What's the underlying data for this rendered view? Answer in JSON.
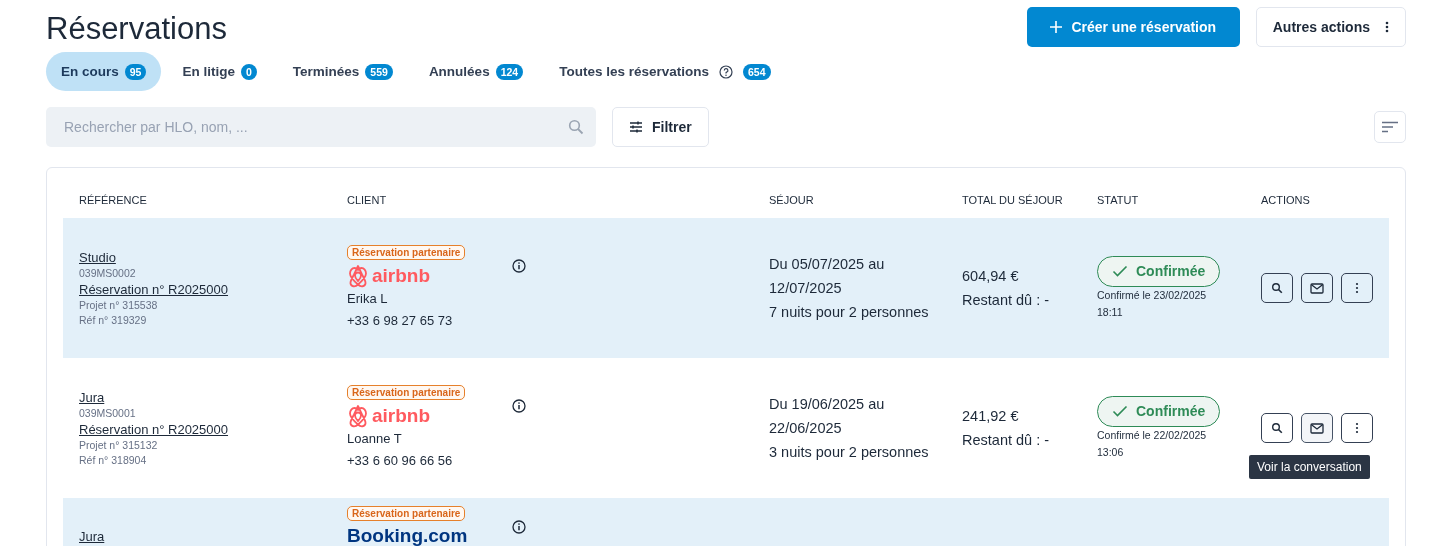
{
  "page": {
    "title": "Réservations",
    "primary_action": "Créer une réservation",
    "secondary_action": "Autres actions"
  },
  "tabs": [
    {
      "label": "En cours",
      "count": "95",
      "selected": true,
      "help": false
    },
    {
      "label": "En litige",
      "count": "0",
      "selected": false,
      "help": false
    },
    {
      "label": "Terminées",
      "count": "559",
      "selected": false,
      "help": false
    },
    {
      "label": "Annulées",
      "count": "124",
      "selected": false,
      "help": false
    },
    {
      "label": "Toutes les réservations",
      "count": "654",
      "selected": false,
      "help": true
    }
  ],
  "search": {
    "placeholder": "Rechercher par HLO, nom, ..."
  },
  "filter_button": "Filtrer",
  "table": {
    "columns": [
      "RÉFÉRENCE",
      "CLIENT",
      "SÉJOUR",
      "TOTAL DU SÉJOUR",
      "STATUT",
      "ACTIONS"
    ],
    "rows": [
      {
        "name": "Studio",
        "code": "039MS0002",
        "reservation": "Réservation n° R2025000",
        "project": "Projet n° 315538",
        "ref": "Réf n° 319329",
        "badge": "Réservation partenaire",
        "platform": {
          "kind": "airbnb",
          "label": "airbnb"
        },
        "client": "Erika L",
        "phone": "+33 6 98 27 65 73",
        "stay": [
          "Du 05/07/2025 au",
          "12/07/2025",
          "7 nuits pour 2 personnes"
        ],
        "total": "604,94 €",
        "due": "Restant dû : -",
        "status": "Confirmée",
        "status_date": "Confirmé le 23/02/2025",
        "status_time": "18:11",
        "message_hovered": false,
        "tooltip": null
      },
      {
        "name": "Jura",
        "code": "039MS0001",
        "reservation": "Réservation n° R2025000",
        "project": "Projet n° 315132",
        "ref": "Réf n° 318904",
        "badge": "Réservation partenaire",
        "platform": {
          "kind": "airbnb",
          "label": "airbnb"
        },
        "client": "Loanne T",
        "phone": "+33 6 60 96 66 56",
        "stay": [
          "Du 19/06/2025 au",
          "22/06/2025",
          "3 nuits pour 2 personnes"
        ],
        "total": "241,92 €",
        "due": "Restant dû : -",
        "status": "Confirmée",
        "status_date": "Confirmé le 22/02/2025",
        "status_time": "13:06",
        "message_hovered": true,
        "tooltip": "Voir la conversation"
      },
      {
        "name": "Jura",
        "badge": "Réservation partenaire",
        "platform": {
          "kind": "booking",
          "label": "Booking.com"
        }
      }
    ]
  }
}
